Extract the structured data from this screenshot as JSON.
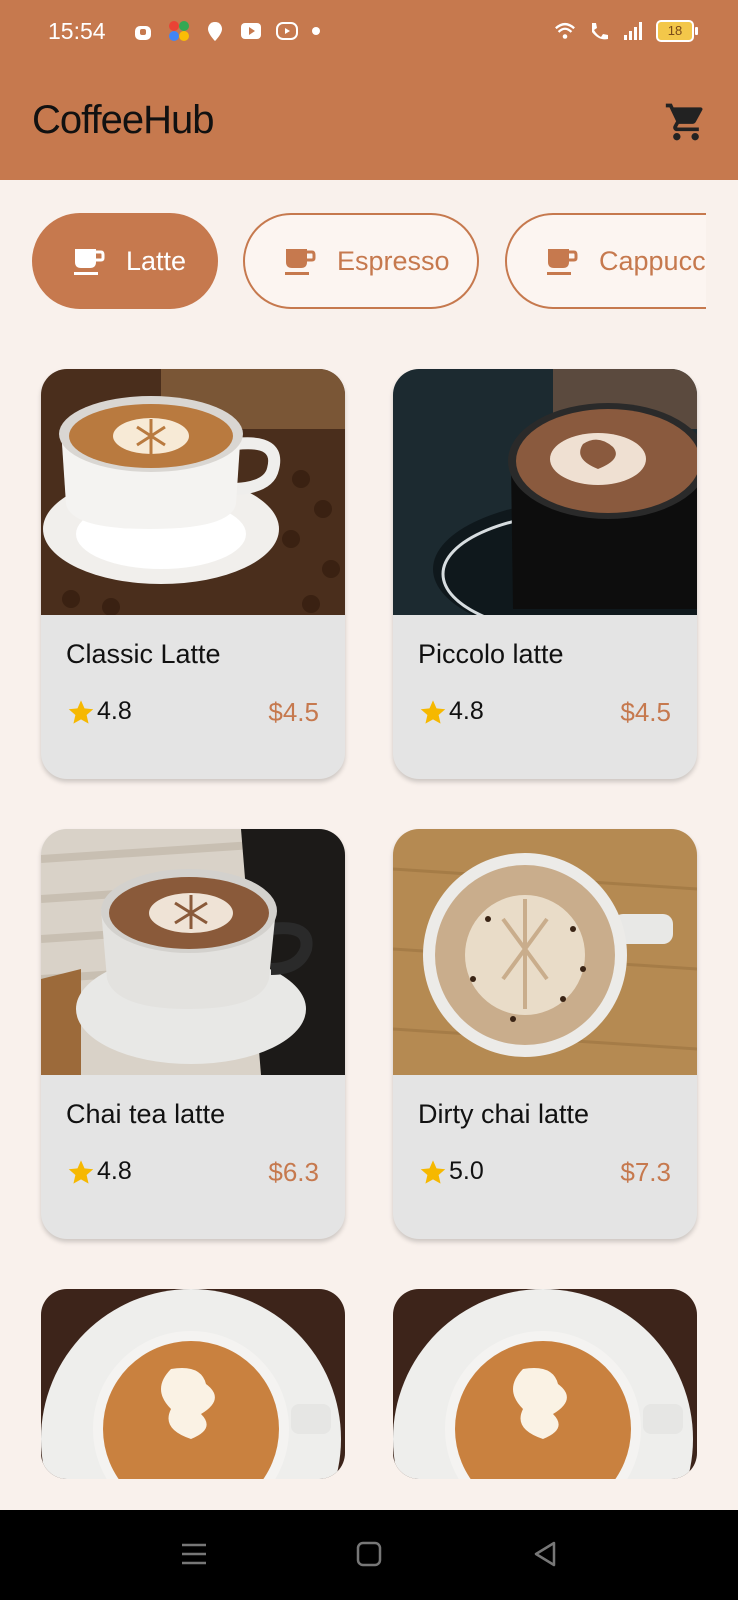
{
  "status_bar": {
    "time": "15:54",
    "battery": "18"
  },
  "app": {
    "title": "CoffeeHub",
    "cart_icon": "cart-icon"
  },
  "categories": [
    {
      "label": "Latte",
      "active": true
    },
    {
      "label": "Espresso",
      "active": false
    },
    {
      "label": "Cappuccino",
      "active": false
    }
  ],
  "products": [
    {
      "name": "Classic Latte",
      "rating": "4.8",
      "price": "$4.5"
    },
    {
      "name": "Piccolo latte",
      "rating": "4.8",
      "price": "$4.5"
    },
    {
      "name": "Chai tea latte",
      "rating": "4.8",
      "price": "$6.3"
    },
    {
      "name": "Dirty chai latte",
      "rating": "5.0",
      "price": "$7.3"
    }
  ],
  "colors": {
    "accent": "#c6794e",
    "background": "#f9f1ec",
    "card": "#e4e4e4",
    "star": "#f6b800"
  }
}
